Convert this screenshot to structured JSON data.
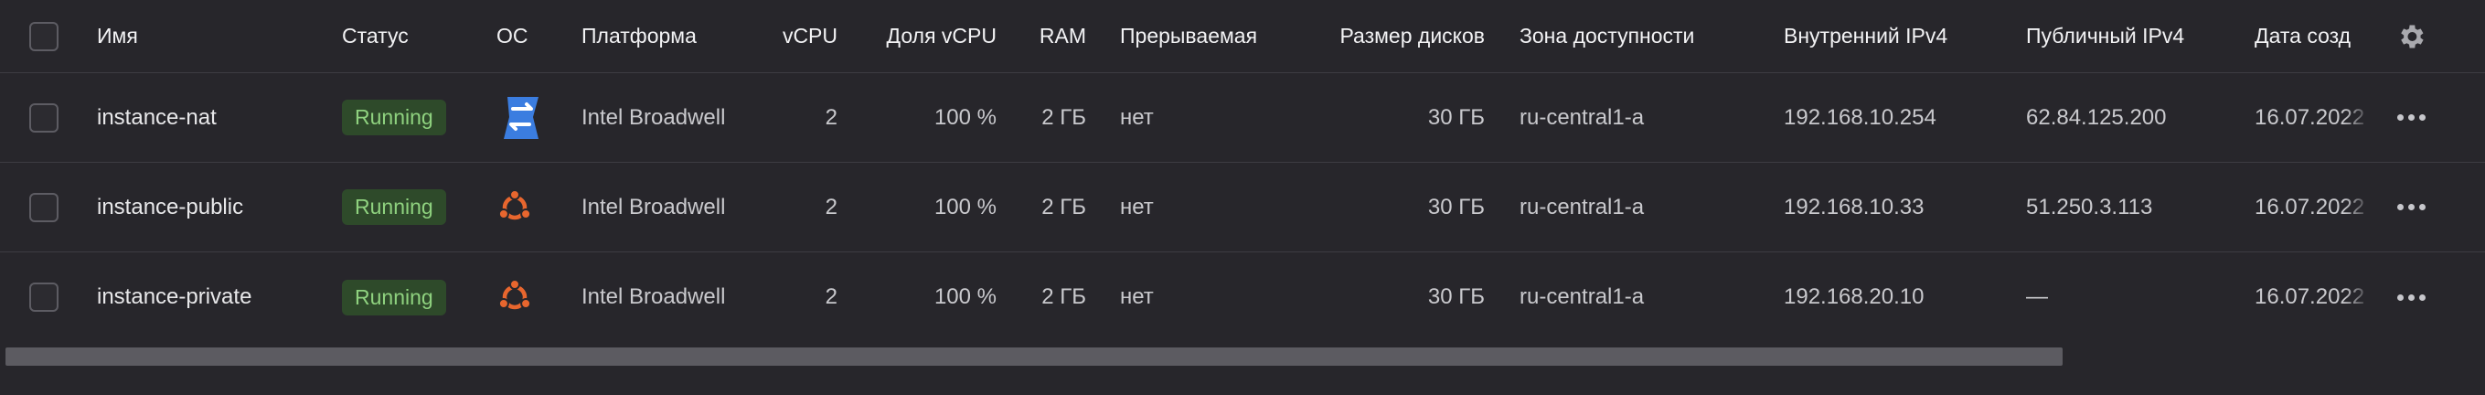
{
  "columns": {
    "name": "Имя",
    "status": "Статус",
    "os": "ОС",
    "platform": "Платформа",
    "vcpu": "vCPU",
    "vcpu_share": "Доля vCPU",
    "ram": "RAM",
    "preemptible": "Прерываемая",
    "disk_size": "Размер дисков",
    "zone": "Зона доступности",
    "internal_ip": "Внутренний IPv4",
    "public_ip": "Публичный IPv4",
    "created": "Дата созд"
  },
  "icons": {
    "settings": "gear-icon",
    "os_nat": "nat-os-icon",
    "os_ubuntu": "ubuntu-icon",
    "actions": "more-dots-icon"
  },
  "colors": {
    "status_bg": "#2e4a2a",
    "status_text": "#8fd27f",
    "nat_icon": "#3b7de0",
    "ubuntu_icon": "#e8662e"
  },
  "rows": [
    {
      "name": "instance-nat",
      "status": "Running",
      "os": "nat",
      "platform": "Intel Broadwell",
      "vcpu": "2",
      "vcpu_share": "100 %",
      "ram": "2 ГБ",
      "preemptible": "нет",
      "disk_size": "30 ГБ",
      "zone": "ru-central1-a",
      "internal_ip": "192.168.10.254",
      "public_ip": "62.84.125.200",
      "created": "16.07.2022"
    },
    {
      "name": "instance-public",
      "status": "Running",
      "os": "ubuntu",
      "platform": "Intel Broadwell",
      "vcpu": "2",
      "vcpu_share": "100 %",
      "ram": "2 ГБ",
      "preemptible": "нет",
      "disk_size": "30 ГБ",
      "zone": "ru-central1-a",
      "internal_ip": "192.168.10.33",
      "public_ip": "51.250.3.113",
      "created": "16.07.2022"
    },
    {
      "name": "instance-private",
      "status": "Running",
      "os": "ubuntu",
      "platform": "Intel Broadwell",
      "vcpu": "2",
      "vcpu_share": "100 %",
      "ram": "2 ГБ",
      "preemptible": "нет",
      "disk_size": "30 ГБ",
      "zone": "ru-central1-a",
      "internal_ip": "192.168.20.10",
      "public_ip": "—",
      "created": "16.07.2022"
    }
  ]
}
